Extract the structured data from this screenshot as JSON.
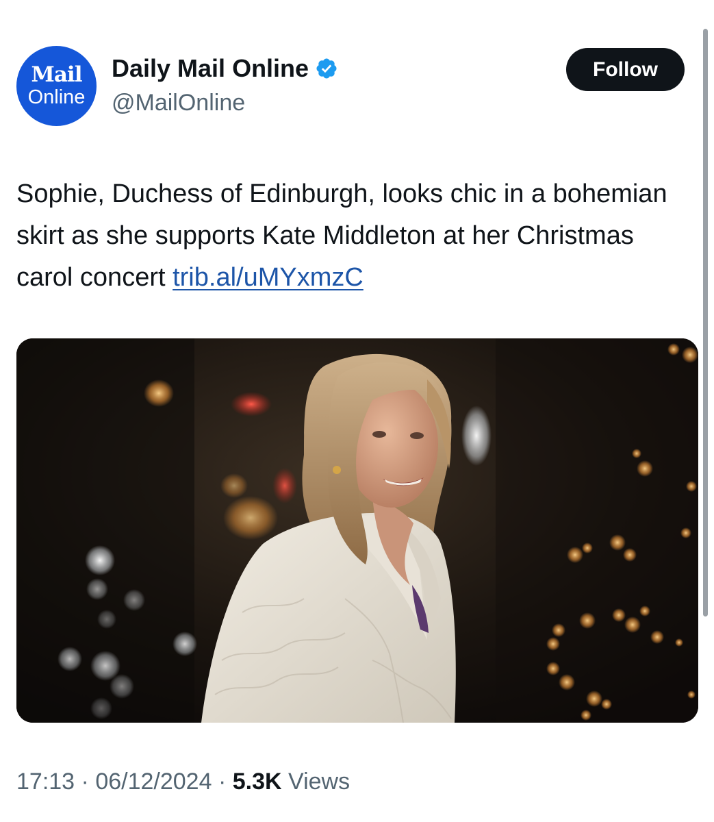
{
  "account": {
    "avatar_line1": "Mail",
    "avatar_line2": "Online",
    "display_name": "Daily Mail Online",
    "handle": "@MailOnline",
    "verified_icon": "verified-badge-icon"
  },
  "follow_label": "Follow",
  "tweet": {
    "text": "Sophie, Duchess of Edinburgh, looks chic in a bohemian skirt as she supports Kate Middleton at her Christmas carol concert ",
    "link": "trib.al/uMYxmzC"
  },
  "media": {
    "description": "photo-of-woman-in-white-coat-at-night"
  },
  "meta": {
    "time": "17:13",
    "separator": "·",
    "date": "06/12/2024",
    "views_count": "5.3K",
    "views_label": "Views"
  },
  "colors": {
    "avatar_blue": "#1557d9",
    "verified_blue": "#1d9bf0",
    "link_blue": "#1d55a8",
    "follow_bg": "#0f1419",
    "secondary_text": "#536471"
  }
}
